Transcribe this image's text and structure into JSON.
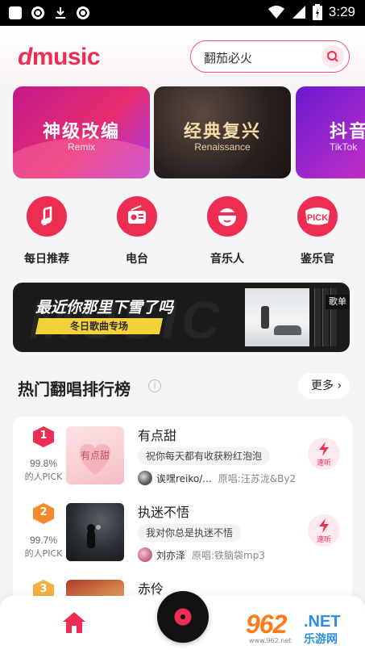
{
  "status_bar": {
    "time": "3:29",
    "icons": [
      "notification-icon",
      "sync-icon",
      "download-icon",
      "sync-icon",
      "wifi-icon",
      "signal-icon",
      "battery-icon"
    ]
  },
  "header": {
    "logo_text": "music",
    "search_placeholder": "翻茄必火"
  },
  "banners": [
    {
      "title": "神级改编",
      "subtitle": "Remix"
    },
    {
      "title": "经典复兴",
      "subtitle": "Renaissance"
    },
    {
      "title": "抖音",
      "subtitle": "TikTok"
    }
  ],
  "quick_entries": [
    {
      "label": "每日推荐",
      "icon": "music-note-icon"
    },
    {
      "label": "电台",
      "icon": "radio-icon"
    },
    {
      "label": "音乐人",
      "icon": "musician-icon"
    },
    {
      "label": "鉴乐官",
      "icon": "pick-icon",
      "icon_text": "PICK"
    }
  ],
  "promo": {
    "title": "最近你那里下雪了吗",
    "tag": "冬日歌曲专场",
    "badge": "歌单",
    "bg_text": "MUSIC"
  },
  "section": {
    "title": "热门翻唱排行榜",
    "info": "i",
    "more": "更多"
  },
  "songs": [
    {
      "rank": "1",
      "pct": "99.8%",
      "pick": "的人PICK",
      "title": "有点甜",
      "lyric": "祝你每天都有收获粉红泡泡",
      "singer": "诶嘿reiko/...",
      "original": "原唱:汪苏泷&By2",
      "listen": "速听",
      "medal_color": "#ee2d52"
    },
    {
      "rank": "2",
      "pct": "99.7%",
      "pick": "的人PICK",
      "title": "执迷不悟",
      "lyric": "我对你总是执迷不悟",
      "singer": "刘亦泽",
      "original": "原唱:铁脑袋mp3",
      "listen": "速听",
      "medal_color": "#f58a2c"
    },
    {
      "rank": "3",
      "title": "赤伶"
    }
  ],
  "watermark": {
    "num": "962",
    "net": ".NET",
    "cn": "乐游网",
    "url": "www.962.net"
  },
  "colors": {
    "accent": "#ee2d52"
  }
}
